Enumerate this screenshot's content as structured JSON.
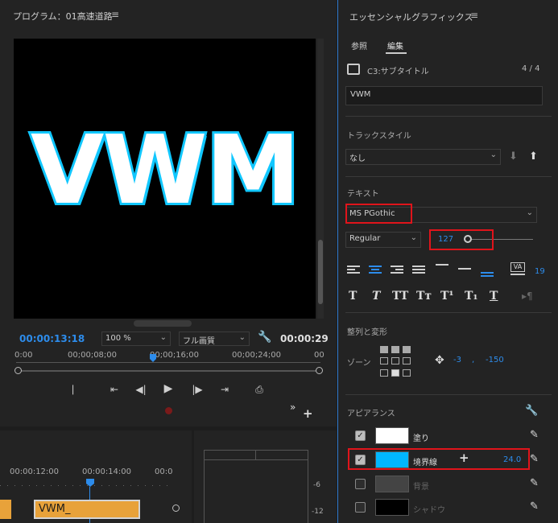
{
  "program": {
    "title": "プログラム：01高速道路",
    "viewer_text": "VWM",
    "timecode_current": "00:00:13:18",
    "zoom": "100 %",
    "quality": "フル画質",
    "timecode_end": "00:00:29",
    "ruler": [
      "0:00",
      "00;00;08;00",
      "00;00;16;00",
      "00;00;24;00",
      "00"
    ]
  },
  "timeline": {
    "ruler": [
      "00:00:12:00",
      "00:00:14:00",
      "00:0"
    ],
    "clip_label": "VWM_"
  },
  "meter": {
    "ticks": [
      "-6",
      "-12"
    ]
  },
  "eg": {
    "title": "エッセンシャルグラフィックス",
    "tabs": [
      "参照",
      "編集"
    ],
    "layer_name": "C3:サブタイトル",
    "layer_count": "4 / 4",
    "text_value": "VWM",
    "track_style_label": "トラックスタイル",
    "track_style_value": "なし",
    "text_section": "テキスト",
    "font": "MS PGothic",
    "font_style": "Regular",
    "font_size": "127",
    "tracking": "19",
    "align_section": "整列と変形",
    "zone_label": "ゾーン",
    "pos_x": "-3",
    "pos_sep": ",",
    "pos_y": "-150",
    "appearance_section": "アピアランス",
    "appearance": [
      {
        "label": "塗り",
        "checked": true,
        "color": "#ffffff"
      },
      {
        "label": "境界線",
        "checked": true,
        "color": "#00b7ff",
        "value": "24.0"
      },
      {
        "label": "背景",
        "checked": false,
        "color": "#444444"
      },
      {
        "label": "シャドウ",
        "checked": false,
        "color": "#000000"
      }
    ],
    "colors": {
      "accent": "#2d8ceb",
      "highlight": "#e0141b"
    }
  }
}
